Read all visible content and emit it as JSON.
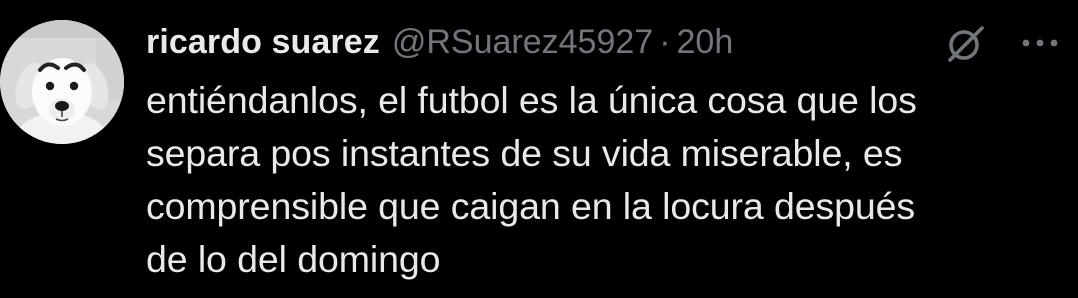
{
  "tweet": {
    "author": {
      "display_name": "ricardo suarez",
      "handle": "@RSuarez45927",
      "avatar_icon": "dog-avatar"
    },
    "separator": "·",
    "timestamp": "20h",
    "icons": {
      "grok": "grok-slash-circle-icon",
      "more": "more-horizontal-icon"
    },
    "text_lines": [
      "entiéndanlos, el futbol es la única cosa que los",
      "separa pos instantes de su vida miserable, es",
      "comprensible que caigan en la locura después",
      "de lo del domingo"
    ]
  },
  "colors": {
    "background": "#000000",
    "primary_text": "#e7e9ea",
    "secondary_text": "#71767b"
  }
}
